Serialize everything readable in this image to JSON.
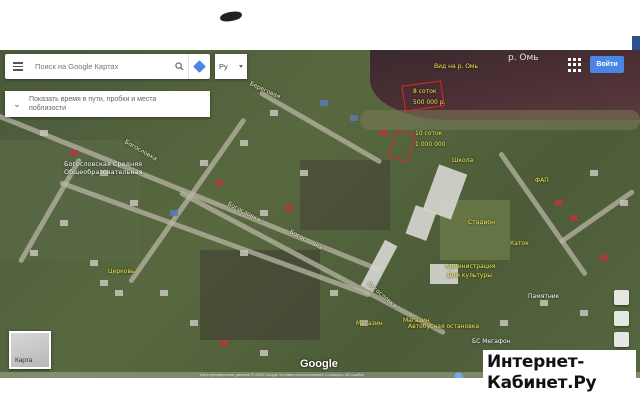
{
  "search": {
    "placeholder": "Поиск на Google Картах",
    "language": "Ру"
  },
  "trip_panel": {
    "line1": "Показать время в пути, пробки и места",
    "line2": "поблизости"
  },
  "header": {
    "signin_label": "Войти"
  },
  "map": {
    "river_label": "р. Омь",
    "view_to_river": "Вид на р. Омь",
    "plot_1": {
      "size": "8 соток",
      "price": "500 000 р."
    },
    "plot_2": {
      "size": "10 соток",
      "price": "1 000 000"
    },
    "places": {
      "school": "Школа",
      "seminary": "Богословская Средняя Общеобразовательная",
      "stadium": "Стадион",
      "katok": "Каток",
      "fap": "ФАП",
      "admin": "Администрация",
      "culture": "Дом культуры",
      "bus_stop": "Автобусная остановка",
      "shop1": "Магазин",
      "shop2": "Магазин",
      "megafon": "БС Мегафон",
      "church": "Церковь",
      "pamyatnik": "Памятник"
    },
    "roads": {
      "r1": "Богословка",
      "r2": "Богословка",
      "r3": "Богословка",
      "r4": "Богословка",
      "r5": "Береговая"
    },
    "map_type_label": "Карта",
    "logo": "Google",
    "copyright": "Картографические данные © 2016 Google   Условия использования   Сообщить об ошибке"
  },
  "watermark": {
    "line1": "Интернет-",
    "line2": "Кабинет.Ру"
  },
  "colors": {
    "plot_outline": "#e0262b",
    "label_yellow": "#f3e84a",
    "signin_blue": "#4a86e8"
  },
  "icons": [
    "menu-icon",
    "search-icon",
    "directions-icon",
    "chevron-down-icon",
    "apps-grid-icon",
    "location-pin-icon"
  ]
}
